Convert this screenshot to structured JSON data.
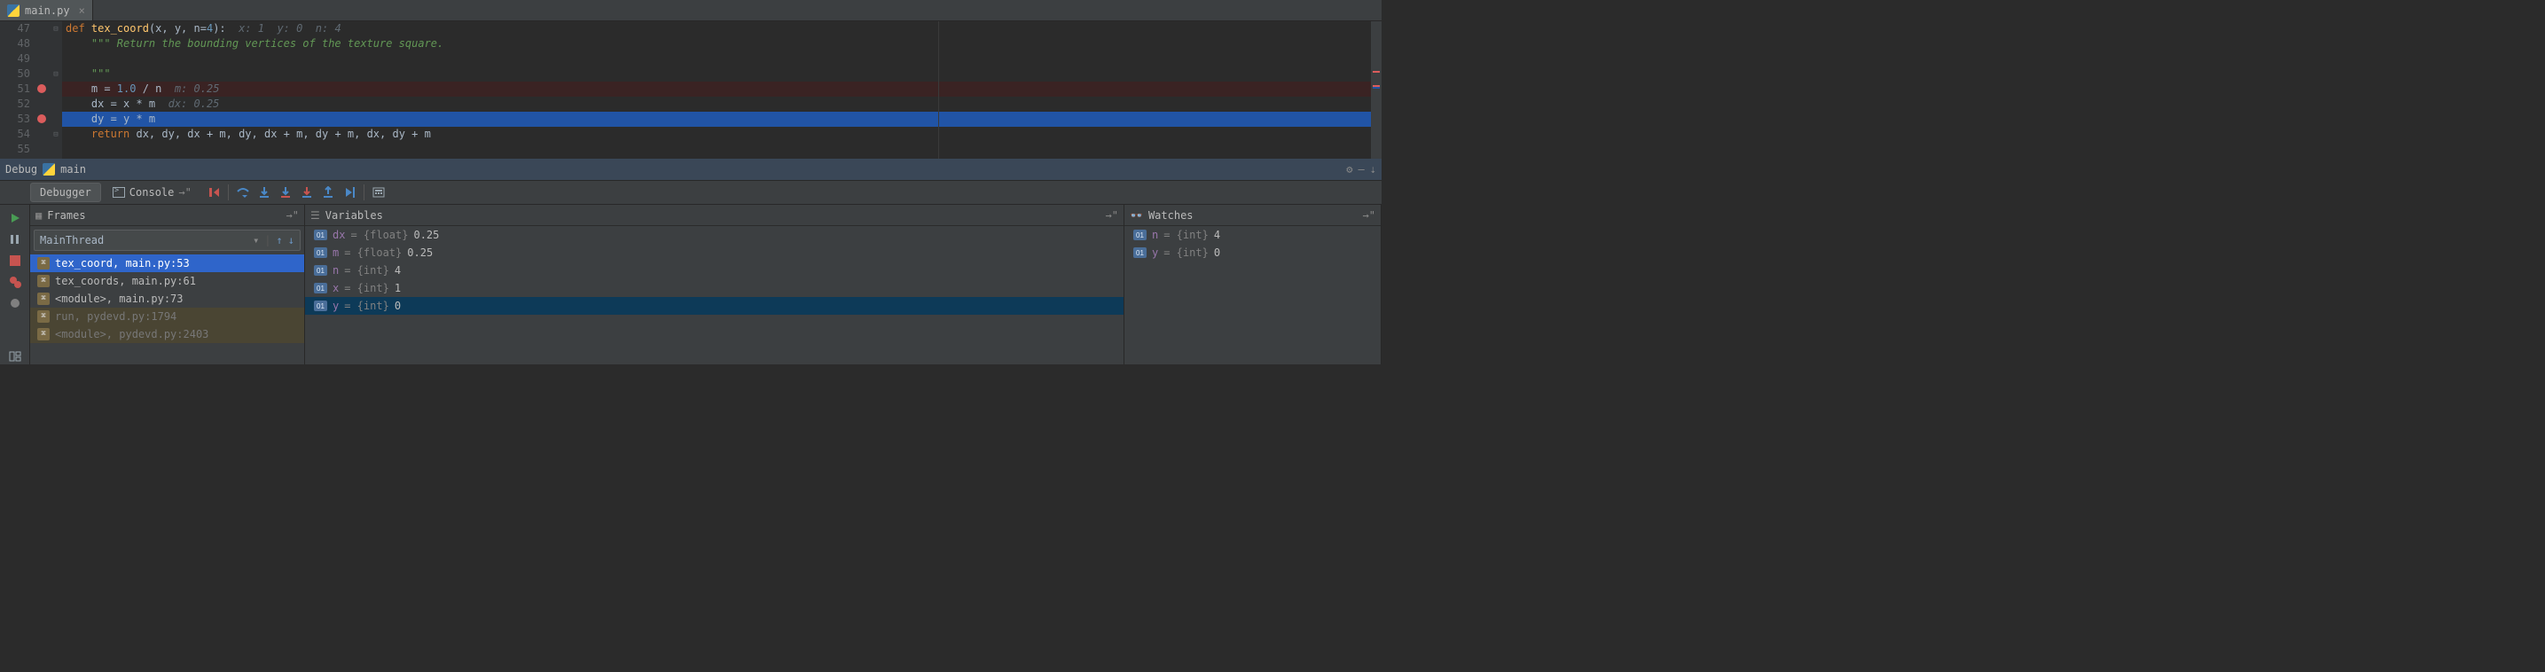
{
  "tab": {
    "filename": "main.py"
  },
  "editor": {
    "lines": [
      {
        "num": "47",
        "bp": false,
        "fold": "-",
        "bg": "",
        "frags": [
          {
            "t": "def ",
            "c": "kw"
          },
          {
            "t": "tex_coord",
            "c": "fname"
          },
          {
            "t": "(x, y, n=",
            "c": "ident"
          },
          {
            "t": "4",
            "c": "num"
          },
          {
            "t": "):  ",
            "c": "ident"
          },
          {
            "t": "x: 1  y: 0  n: 4",
            "c": "hint"
          }
        ]
      },
      {
        "num": "48",
        "bp": false,
        "fold": "",
        "bg": "",
        "frags": [
          {
            "t": "    \"\"\" Return the bounding vertices of the texture square.",
            "c": "str"
          }
        ]
      },
      {
        "num": "49",
        "bp": false,
        "fold": "",
        "bg": "",
        "frags": [
          {
            "t": "",
            "c": "ident"
          }
        ]
      },
      {
        "num": "50",
        "bp": false,
        "fold": "-",
        "bg": "",
        "frags": [
          {
            "t": "    \"\"\"",
            "c": "str"
          }
        ]
      },
      {
        "num": "51",
        "bp": true,
        "fold": "",
        "bg": "bp",
        "frags": [
          {
            "t": "    m = ",
            "c": "ident"
          },
          {
            "t": "1.0",
            "c": "num"
          },
          {
            "t": " / n  ",
            "c": "ident"
          },
          {
            "t": "m: 0.25",
            "c": "hint"
          }
        ]
      },
      {
        "num": "52",
        "bp": false,
        "fold": "",
        "bg": "",
        "frags": [
          {
            "t": "    dx = x * m  ",
            "c": "ident"
          },
          {
            "t": "dx: 0.25",
            "c": "hint"
          }
        ]
      },
      {
        "num": "53",
        "bp": true,
        "fold": "",
        "bg": "curr",
        "frags": [
          {
            "t": "    dy = y * m",
            "c": "ident"
          }
        ]
      },
      {
        "num": "54",
        "bp": false,
        "fold": "-",
        "bg": "",
        "frags": [
          {
            "t": "    ",
            "c": "ident"
          },
          {
            "t": "return ",
            "c": "kw"
          },
          {
            "t": "dx, dy, dx + m, dy, dx + m, dy + m, dx, dy + m",
            "c": "ident"
          }
        ]
      },
      {
        "num": "55",
        "bp": false,
        "fold": "",
        "bg": "",
        "frags": [
          {
            "t": "",
            "c": "ident"
          }
        ]
      }
    ]
  },
  "debug_header": {
    "label": "Debug",
    "run_name": "main"
  },
  "dbg_tabs": {
    "debugger": "Debugger",
    "console": "Console"
  },
  "frames": {
    "title": "Frames",
    "thread": "MainThread",
    "items": [
      {
        "label": "tex_coord, main.py:53",
        "sel": true,
        "dim": false
      },
      {
        "label": "tex_coords, main.py:61",
        "sel": false,
        "dim": false
      },
      {
        "label": "<module>, main.py:73",
        "sel": false,
        "dim": false
      },
      {
        "label": "run, pydevd.py:1794",
        "sel": false,
        "dim": true
      },
      {
        "label": "<module>, pydevd.py:2403",
        "sel": false,
        "dim": true
      }
    ]
  },
  "variables": {
    "title": "Variables",
    "items": [
      {
        "name": "dx",
        "type": "{float}",
        "value": "0.25",
        "sel": false
      },
      {
        "name": "m",
        "type": "{float}",
        "value": "0.25",
        "sel": false
      },
      {
        "name": "n",
        "type": "{int}",
        "value": "4",
        "sel": false
      },
      {
        "name": "x",
        "type": "{int}",
        "value": "1",
        "sel": false
      },
      {
        "name": "y",
        "type": "{int}",
        "value": "0",
        "sel": true
      }
    ]
  },
  "watches": {
    "title": "Watches",
    "items": [
      {
        "name": "n",
        "type": "{int}",
        "value": "4"
      },
      {
        "name": "y",
        "type": "{int}",
        "value": "0"
      }
    ]
  }
}
